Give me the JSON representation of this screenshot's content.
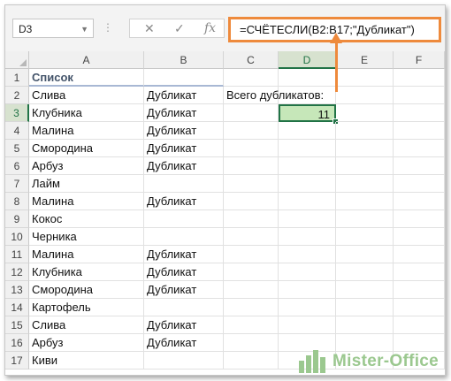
{
  "name_box": "D3",
  "formula": "=СЧЁТЕСЛИ(B2:B17;\"Дубликат\")",
  "formula_bar_buttons": {
    "cancel": "✕",
    "enter": "✓",
    "fx": "fx"
  },
  "columns": [
    "A",
    "B",
    "C",
    "D",
    "E",
    "F"
  ],
  "active_column": "D",
  "active_row": 3,
  "rows": [
    {
      "n": "1",
      "a": "Список",
      "b": "",
      "c": "",
      "d": ""
    },
    {
      "n": "2",
      "a": "Слива",
      "b": "Дубликат",
      "c": "Всего дубликатов:",
      "d": ""
    },
    {
      "n": "3",
      "a": "Клубника",
      "b": "Дубликат",
      "c": "",
      "d": "11"
    },
    {
      "n": "4",
      "a": "Малина",
      "b": "Дубликат",
      "c": "",
      "d": ""
    },
    {
      "n": "5",
      "a": "Смородина",
      "b": "Дубликат",
      "c": "",
      "d": ""
    },
    {
      "n": "6",
      "a": "Арбуз",
      "b": "Дубликат",
      "c": "",
      "d": ""
    },
    {
      "n": "7",
      "a": "Лайм",
      "b": "",
      "c": "",
      "d": ""
    },
    {
      "n": "8",
      "a": "Малина",
      "b": "Дубликат",
      "c": "",
      "d": ""
    },
    {
      "n": "9",
      "a": "Кокос",
      "b": "",
      "c": "",
      "d": ""
    },
    {
      "n": "10",
      "a": "Черника",
      "b": "",
      "c": "",
      "d": ""
    },
    {
      "n": "11",
      "a": "Малина",
      "b": "Дубликат",
      "c": "",
      "d": ""
    },
    {
      "n": "12",
      "a": "Клубника",
      "b": "Дубликат",
      "c": "",
      "d": ""
    },
    {
      "n": "13",
      "a": "Смородина",
      "b": "Дубликат",
      "c": "",
      "d": ""
    },
    {
      "n": "14",
      "a": "Картофель",
      "b": "",
      "c": "",
      "d": ""
    },
    {
      "n": "15",
      "a": "Слива",
      "b": "Дубликат",
      "c": "",
      "d": ""
    },
    {
      "n": "16",
      "a": "Арбуз",
      "b": "Дубликат",
      "c": "",
      "d": ""
    },
    {
      "n": "17",
      "a": "Киви",
      "b": "",
      "c": "",
      "d": ""
    }
  ],
  "watermark": "Mister-Office",
  "colors": {
    "accent_orange": "#ee8a3c",
    "excel_green": "#217346",
    "selected_fill": "#c6e7b9",
    "watermark": "#9bc88f"
  }
}
